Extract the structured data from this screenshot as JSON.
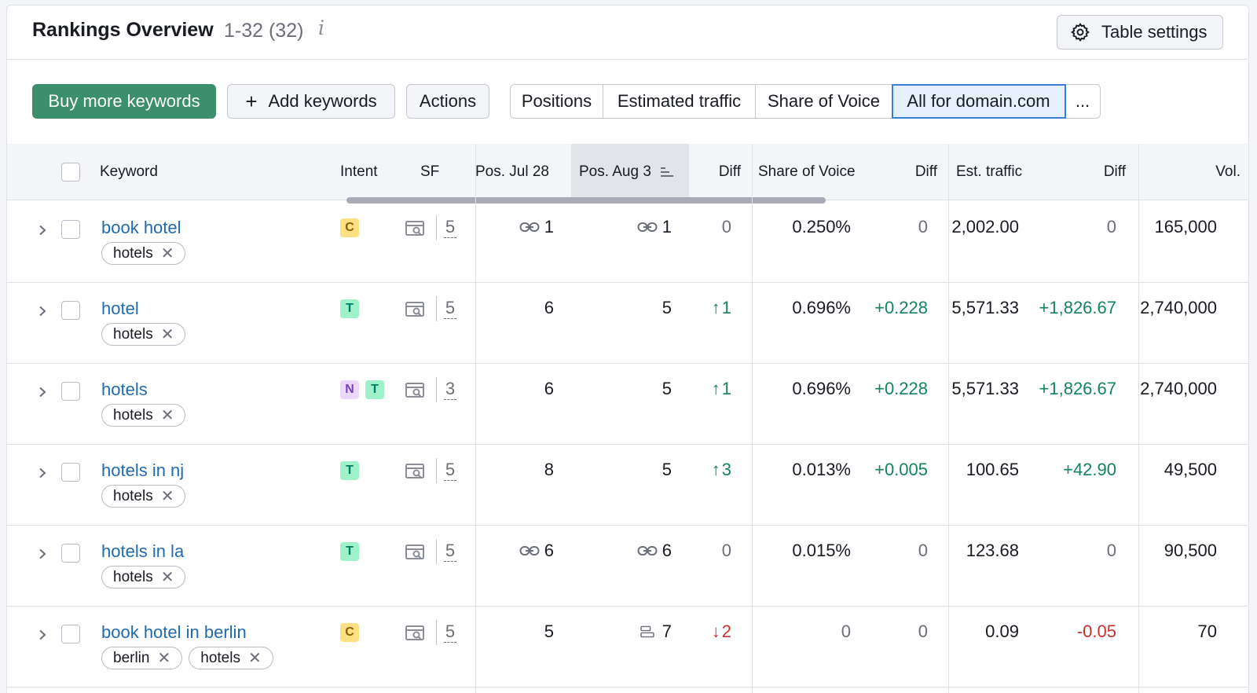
{
  "header": {
    "title": "Rankings Overview",
    "count": "1-32 (32)",
    "info_glyph": "i",
    "table_settings_label": "Table settings"
  },
  "toolbar": {
    "buy_label": "Buy more keywords",
    "add_label": "Add keywords",
    "add_glyph": "+",
    "actions_label": "Actions",
    "segments": [
      "Positions",
      "Estimated traffic",
      "Share of Voice",
      "All for domain.com",
      "..."
    ],
    "active_segment": "All for domain.com"
  },
  "columns": {
    "keyword": "Keyword",
    "intent": "Intent",
    "sf": "SF",
    "pos_prev": "Pos. Jul 28",
    "pos_cur": "Pos. Aug 3",
    "diff": "Diff",
    "sov": "Share of Voice",
    "sov_diff": "Diff",
    "traffic": "Est. traffic",
    "traffic_diff": "Diff",
    "volume": "Vol."
  },
  "rows": [
    {
      "keyword": "book hotel",
      "tags": [
        "hotels"
      ],
      "intents": [
        "C"
      ],
      "sf": "5",
      "pos_prev": "1",
      "pos_prev_icon": "link-icon",
      "pos_cur": "1",
      "pos_cur_icon": "link-icon",
      "diff": "0",
      "diff_dir": "none",
      "sov": "0.250%",
      "sov_diff": "0",
      "traffic": "2,002.00",
      "traffic_diff": "0",
      "volume": "165,000"
    },
    {
      "keyword": "hotel",
      "tags": [
        "hotels"
      ],
      "intents": [
        "T"
      ],
      "sf": "5",
      "pos_prev": "6",
      "pos_prev_icon": "",
      "pos_cur": "5",
      "pos_cur_icon": "",
      "diff": "1",
      "diff_dir": "up",
      "sov": "0.696%",
      "sov_diff": "+0.228",
      "traffic": "5,571.33",
      "traffic_diff": "+1,826.67",
      "volume": "2,740,000"
    },
    {
      "keyword": "hotels",
      "tags": [
        "hotels"
      ],
      "intents": [
        "N",
        "T"
      ],
      "sf": "3",
      "pos_prev": "6",
      "pos_prev_icon": "",
      "pos_cur": "5",
      "pos_cur_icon": "",
      "diff": "1",
      "diff_dir": "up",
      "sov": "0.696%",
      "sov_diff": "+0.228",
      "traffic": "5,571.33",
      "traffic_diff": "+1,826.67",
      "volume": "2,740,000"
    },
    {
      "keyword": "hotels in nj",
      "tags": [
        "hotels"
      ],
      "intents": [
        "T"
      ],
      "sf": "5",
      "pos_prev": "8",
      "pos_prev_icon": "",
      "pos_cur": "5",
      "pos_cur_icon": "",
      "diff": "3",
      "diff_dir": "up",
      "sov": "0.013%",
      "sov_diff": "+0.005",
      "traffic": "100.65",
      "traffic_diff": "+42.90",
      "volume": "49,500"
    },
    {
      "keyword": "hotels in la",
      "tags": [
        "hotels"
      ],
      "intents": [
        "T"
      ],
      "sf": "5",
      "pos_prev": "6",
      "pos_prev_icon": "link-icon",
      "pos_cur": "6",
      "pos_cur_icon": "link-icon",
      "diff": "0",
      "diff_dir": "none",
      "sov": "0.015%",
      "sov_diff": "0",
      "traffic": "123.68",
      "traffic_diff": "0",
      "volume": "90,500"
    },
    {
      "keyword": "book hotel in berlin",
      "tags": [
        "berlin",
        "hotels"
      ],
      "intents": [
        "C"
      ],
      "sf": "5",
      "pos_prev": "5",
      "pos_prev_icon": "",
      "pos_cur": "7",
      "pos_cur_icon": "featured-snippet-icon",
      "diff": "2",
      "diff_dir": "down",
      "sov": "0",
      "sov_diff": "0",
      "traffic": "0.09",
      "traffic_diff": "-0.05",
      "volume": "70"
    }
  ],
  "colors": {
    "accent_green": "#3b8f6a",
    "link_blue": "#1f6ab1",
    "positive": "#14845a",
    "negative": "#c8302f",
    "active_segment_border": "#3a7edc"
  }
}
